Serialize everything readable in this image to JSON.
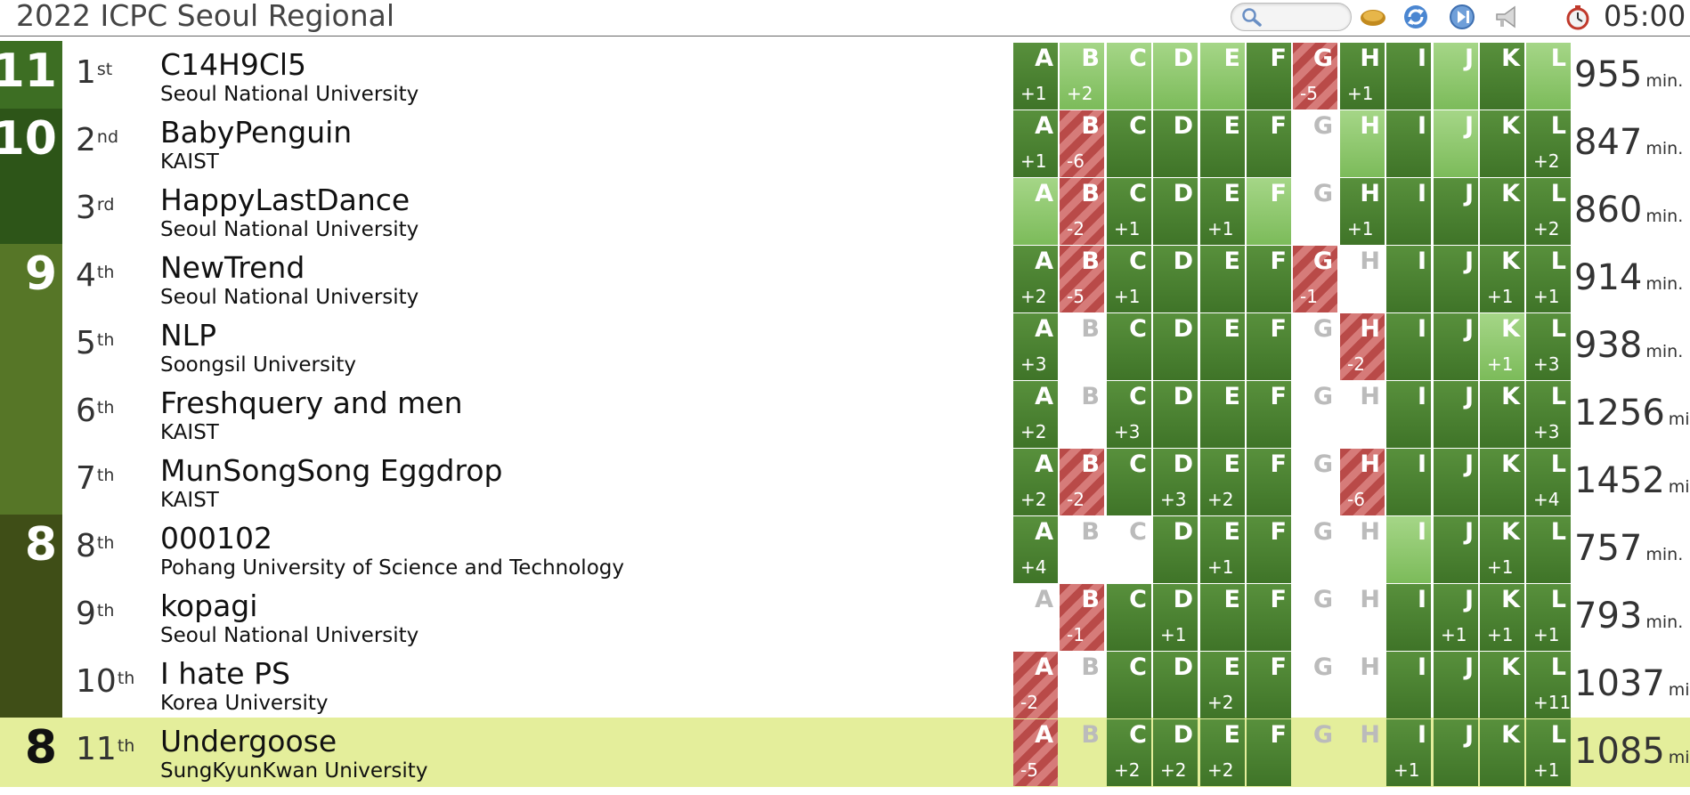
{
  "header": {
    "title": "2022 ICPC Seoul Regional",
    "search_placeholder": "",
    "clock": "05:00"
  },
  "problems": [
    "A",
    "B",
    "C",
    "D",
    "E",
    "F",
    "G",
    "H",
    "I",
    "J",
    "K",
    "L"
  ],
  "groups": [
    {
      "solved": "11",
      "first_row": 0,
      "rows": 1,
      "color": "#3d6e23"
    },
    {
      "solved": "10",
      "first_row": 1,
      "rows": 2,
      "color": "#2d5518"
    },
    {
      "solved": "9",
      "first_row": 3,
      "rows": 4,
      "color": "#567627"
    },
    {
      "solved": "8",
      "first_row": 7,
      "rows": 3,
      "color": "#3f4e17"
    },
    {
      "solved": "8",
      "first_row": 10,
      "rows": 1,
      "color": ""
    }
  ],
  "rows": [
    {
      "rank": "1",
      "suffix": "st",
      "team": "C14H9Cl5",
      "univ": "Seoul National University",
      "score": "955",
      "unit": "min.",
      "highlight": false,
      "cells": [
        [
          "solved",
          "+1"
        ],
        [
          "first",
          "+2"
        ],
        [
          "first",
          ""
        ],
        [
          "first",
          ""
        ],
        [
          "first",
          ""
        ],
        [
          "solved",
          ""
        ],
        [
          "wrong",
          "-5"
        ],
        [
          "solved",
          "+1"
        ],
        [
          "solved",
          ""
        ],
        [
          "first",
          ""
        ],
        [
          "solved",
          ""
        ],
        [
          "first",
          ""
        ]
      ]
    },
    {
      "rank": "2",
      "suffix": "nd",
      "team": "BabyPenguin",
      "univ": "KAIST",
      "score": "847",
      "unit": "min.",
      "highlight": false,
      "cells": [
        [
          "solved",
          "+1"
        ],
        [
          "wrong",
          "-6"
        ],
        [
          "solved",
          ""
        ],
        [
          "solved",
          ""
        ],
        [
          "solved",
          ""
        ],
        [
          "solved",
          ""
        ],
        [
          "none",
          ""
        ],
        [
          "first",
          ""
        ],
        [
          "solved",
          ""
        ],
        [
          "first",
          ""
        ],
        [
          "solved",
          ""
        ],
        [
          "solved",
          "+2"
        ]
      ]
    },
    {
      "rank": "3",
      "suffix": "rd",
      "team": "HappyLastDance",
      "univ": "Seoul National University",
      "score": "860",
      "unit": "min.",
      "highlight": false,
      "cells": [
        [
          "first",
          ""
        ],
        [
          "wrong",
          "-2"
        ],
        [
          "solved",
          "+1"
        ],
        [
          "solved",
          ""
        ],
        [
          "solved",
          "+1"
        ],
        [
          "first",
          ""
        ],
        [
          "none",
          ""
        ],
        [
          "solved",
          "+1"
        ],
        [
          "solved",
          ""
        ],
        [
          "solved",
          ""
        ],
        [
          "solved",
          ""
        ],
        [
          "solved",
          "+2"
        ]
      ]
    },
    {
      "rank": "4",
      "suffix": "th",
      "team": "NewTrend",
      "univ": "Seoul National University",
      "score": "914",
      "unit": "min.",
      "highlight": false,
      "cells": [
        [
          "solved",
          "+2"
        ],
        [
          "wrong",
          "-5"
        ],
        [
          "solved",
          "+1"
        ],
        [
          "solved",
          ""
        ],
        [
          "solved",
          ""
        ],
        [
          "solved",
          ""
        ],
        [
          "wrong",
          "-1"
        ],
        [
          "none",
          ""
        ],
        [
          "solved",
          ""
        ],
        [
          "solved",
          ""
        ],
        [
          "solved",
          "+1"
        ],
        [
          "solved",
          "+1"
        ]
      ]
    },
    {
      "rank": "5",
      "suffix": "th",
      "team": "NLP",
      "univ": "Soongsil University",
      "score": "938",
      "unit": "min.",
      "highlight": false,
      "cells": [
        [
          "solved",
          "+3"
        ],
        [
          "none",
          ""
        ],
        [
          "solved",
          ""
        ],
        [
          "solved",
          ""
        ],
        [
          "solved",
          ""
        ],
        [
          "solved",
          ""
        ],
        [
          "none",
          ""
        ],
        [
          "wrong",
          "-2"
        ],
        [
          "solved",
          ""
        ],
        [
          "solved",
          ""
        ],
        [
          "first",
          "+1"
        ],
        [
          "solved",
          "+3"
        ]
      ]
    },
    {
      "rank": "6",
      "suffix": "th",
      "team": "Freshquery and men",
      "univ": "KAIST",
      "score": "1256",
      "unit": "min.",
      "highlight": false,
      "cells": [
        [
          "solved",
          "+2"
        ],
        [
          "none",
          ""
        ],
        [
          "solved",
          "+3"
        ],
        [
          "solved",
          ""
        ],
        [
          "solved",
          ""
        ],
        [
          "solved",
          ""
        ],
        [
          "none",
          ""
        ],
        [
          "none",
          ""
        ],
        [
          "solved",
          ""
        ],
        [
          "solved",
          ""
        ],
        [
          "solved",
          ""
        ],
        [
          "solved",
          "+3"
        ]
      ]
    },
    {
      "rank": "7",
      "suffix": "th",
      "team": "MunSongSong Eggdrop",
      "univ": "KAIST",
      "score": "1452",
      "unit": "min.",
      "highlight": false,
      "cells": [
        [
          "solved",
          "+2"
        ],
        [
          "wrong",
          "-2"
        ],
        [
          "solved",
          ""
        ],
        [
          "solved",
          "+3"
        ],
        [
          "solved",
          "+2"
        ],
        [
          "solved",
          ""
        ],
        [
          "none",
          ""
        ],
        [
          "wrong",
          "-6"
        ],
        [
          "solved",
          ""
        ],
        [
          "solved",
          ""
        ],
        [
          "solved",
          ""
        ],
        [
          "solved",
          "+4"
        ]
      ]
    },
    {
      "rank": "8",
      "suffix": "th",
      "team": "000102",
      "univ": "Pohang University of Science and Technology",
      "score": "757",
      "unit": "min.",
      "highlight": false,
      "cells": [
        [
          "solved",
          "+4"
        ],
        [
          "none",
          ""
        ],
        [
          "none",
          ""
        ],
        [
          "solved",
          ""
        ],
        [
          "solved",
          "+1"
        ],
        [
          "solved",
          ""
        ],
        [
          "none",
          ""
        ],
        [
          "none",
          ""
        ],
        [
          "first",
          ""
        ],
        [
          "solved",
          ""
        ],
        [
          "solved",
          "+1"
        ],
        [
          "solved",
          ""
        ]
      ]
    },
    {
      "rank": "9",
      "suffix": "th",
      "team": "kopagi",
      "univ": "Seoul National University",
      "score": "793",
      "unit": "min.",
      "highlight": false,
      "cells": [
        [
          "none",
          ""
        ],
        [
          "wrong",
          "-1"
        ],
        [
          "solved",
          ""
        ],
        [
          "solved",
          "+1"
        ],
        [
          "solved",
          ""
        ],
        [
          "solved",
          ""
        ],
        [
          "none",
          ""
        ],
        [
          "none",
          ""
        ],
        [
          "solved",
          ""
        ],
        [
          "solved",
          "+1"
        ],
        [
          "solved",
          "+1"
        ],
        [
          "solved",
          "+1"
        ]
      ]
    },
    {
      "rank": "10",
      "suffix": "th",
      "team": "I hate PS",
      "univ": "Korea University",
      "score": "1037",
      "unit": "min.",
      "highlight": false,
      "cells": [
        [
          "wrong",
          "-2"
        ],
        [
          "none",
          ""
        ],
        [
          "solved",
          ""
        ],
        [
          "solved",
          ""
        ],
        [
          "solved",
          "+2"
        ],
        [
          "solved",
          ""
        ],
        [
          "none",
          ""
        ],
        [
          "none",
          ""
        ],
        [
          "solved",
          ""
        ],
        [
          "solved",
          ""
        ],
        [
          "solved",
          ""
        ],
        [
          "solved",
          "+11"
        ]
      ]
    },
    {
      "rank": "11",
      "suffix": "th",
      "team": "Undergoose",
      "univ": "SungKyunKwan University",
      "score": "1085",
      "unit": "min.",
      "highlight": true,
      "cells": [
        [
          "wrong",
          "-5"
        ],
        [
          "none",
          ""
        ],
        [
          "solved",
          "+2"
        ],
        [
          "solved",
          "+2"
        ],
        [
          "solved",
          "+2"
        ],
        [
          "solved",
          ""
        ],
        [
          "none",
          ""
        ],
        [
          "none",
          ""
        ],
        [
          "solved",
          "+1"
        ],
        [
          "solved",
          ""
        ],
        [
          "solved",
          ""
        ],
        [
          "solved",
          "+1"
        ]
      ]
    }
  ]
}
